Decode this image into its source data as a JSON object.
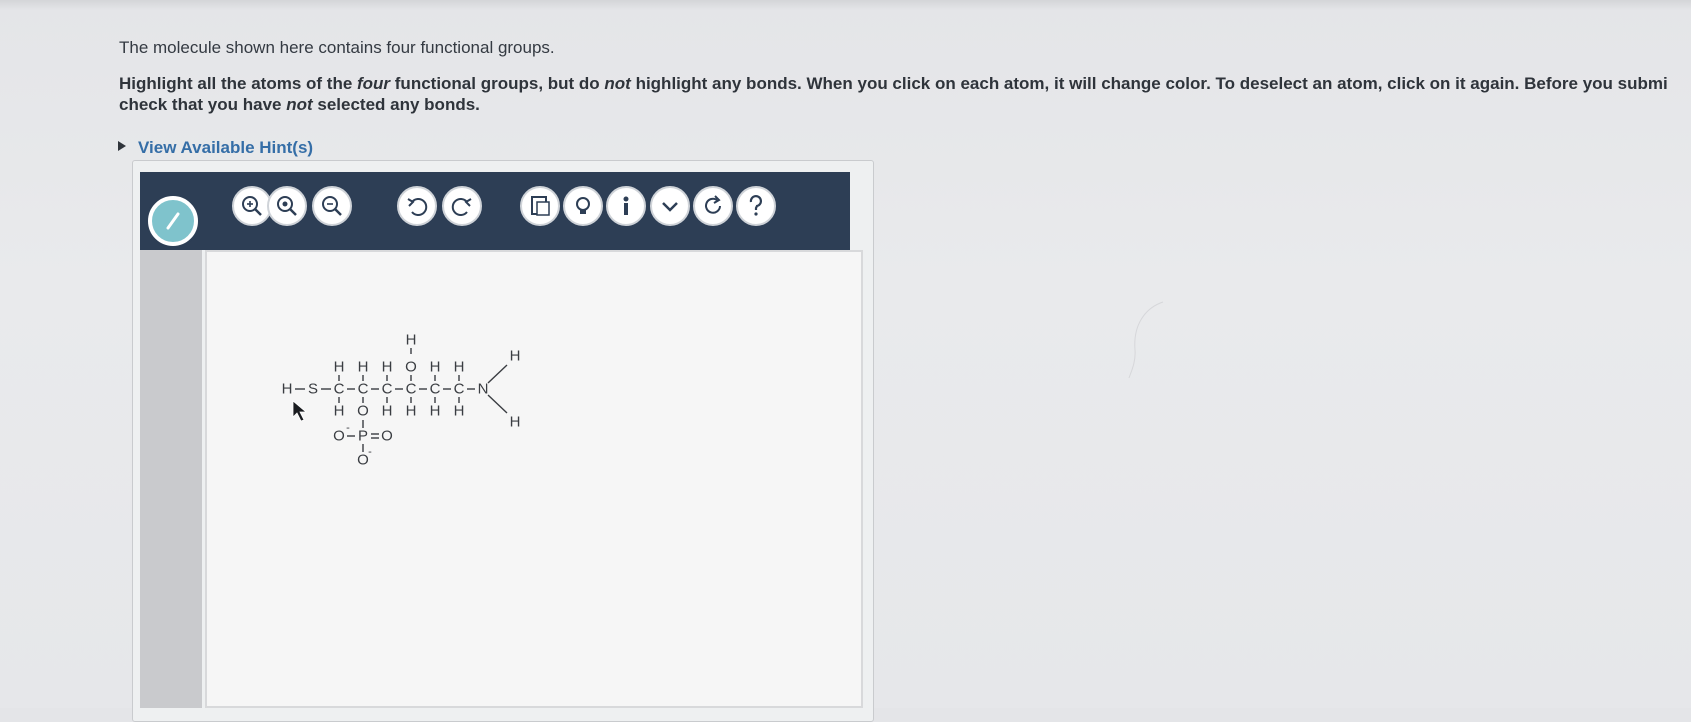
{
  "instructions": {
    "line1": "The molecule shown here contains four functional groups.",
    "line2_part1": "Highlight all the atoms of the ",
    "line2_em1": "four",
    "line2_part2": " functional groups, but do ",
    "line2_em2": "not",
    "line2_part3": " highlight any bonds. When you click on each atom, it will change color. To deselect an atom, click on it again. Before you submi",
    "line3_part1": "check that you have ",
    "line3_em": "not",
    "line3_part2": " selected any bonds."
  },
  "hint": {
    "label": "View Available Hint(s)"
  },
  "toolbar": {
    "buttons": [
      {
        "icon": "draw-pencil-icon"
      },
      {
        "icon": "zoom-in-icon"
      },
      {
        "icon": "zoom-reset-icon"
      },
      {
        "icon": "zoom-out-icon"
      },
      {
        "icon": "undo-icon"
      },
      {
        "icon": "redo-icon"
      },
      {
        "icon": "templates-icon"
      },
      {
        "icon": "lightbulb-icon"
      },
      {
        "icon": "info-icon"
      },
      {
        "icon": "chevron-down-icon"
      },
      {
        "icon": "refresh-icon"
      },
      {
        "icon": "help-icon"
      }
    ],
    "accent": "#2d3e55",
    "draw_active_color": "#7fc3cc"
  },
  "molecule": {
    "atoms": {
      "H_left": "H",
      "S": "S",
      "C1": "C",
      "C2": "C",
      "C3": "C",
      "C4": "C",
      "C5": "C",
      "C6": "C",
      "N": "N",
      "H_c1_top": "H",
      "H_c2_top": "H",
      "H_c3_top": "H",
      "O_c4_top": "O",
      "H_o4": "H",
      "H_c5_top": "H",
      "H_c6_top": "H",
      "H_c1_bot": "H",
      "O_c2_bot": "O",
      "H_c3_bot": "H",
      "H_c4_bot": "H",
      "H_c5_bot": "H",
      "H_c6_bot": "H",
      "P": "P",
      "O_p_left": "O",
      "O_p_right": "O",
      "O_p_bot": "O",
      "H_n_top": "H",
      "H_n_bot": "H",
      "charge_left": "-",
      "charge_bot": "-"
    }
  }
}
